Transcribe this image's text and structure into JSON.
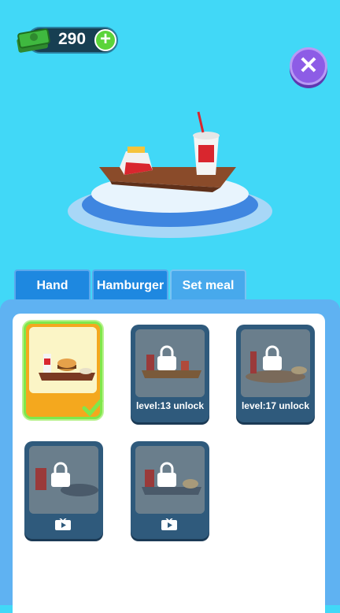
{
  "currency": {
    "amount": "290",
    "add_icon": "plus-icon",
    "money_icon": "cash-stack-icon"
  },
  "close_icon": "close-icon",
  "preview": {
    "item": "tray with fries box and soda cup on round pedestal"
  },
  "tabs": [
    {
      "label": "Hand",
      "active": false
    },
    {
      "label": "Hamburger",
      "active": false
    },
    {
      "label": "Set meal",
      "active": true
    }
  ],
  "cards": [
    {
      "state": "selected",
      "caption": "",
      "icon": "check-icon"
    },
    {
      "state": "locked",
      "caption": "level:13 unlock",
      "icon": "lock-icon"
    },
    {
      "state": "locked",
      "caption": "level:17 unlock",
      "icon": "lock-icon"
    },
    {
      "state": "locked-ad",
      "caption": "",
      "icon": "video-ad-icon"
    },
    {
      "state": "locked-ad",
      "caption": "",
      "icon": "video-ad-icon"
    }
  ],
  "colors": {
    "background": "#41d8f7",
    "tab_active": "#47a9ec",
    "tab": "#1e88e0",
    "card": "#2f5a7c",
    "selected": "#f4a81e"
  }
}
